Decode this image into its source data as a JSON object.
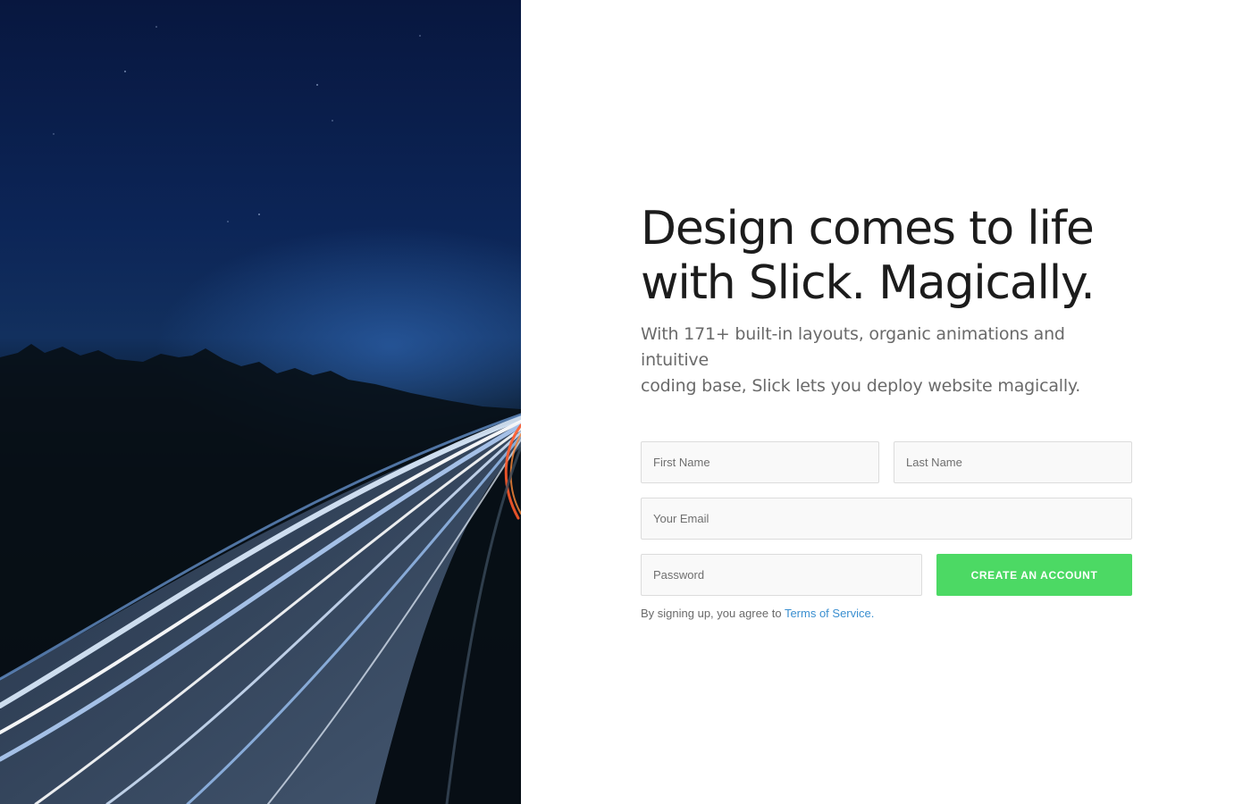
{
  "hero": {
    "image_description_icon": "highway-light-trails-image"
  },
  "headline": {
    "line1": "Design comes to life",
    "line2": "with Slick. Magically."
  },
  "subtitle": {
    "line1": "With 171+ built-in layouts, organic animations and intuitive",
    "line2": "coding base, Slick lets you deploy website magically."
  },
  "form": {
    "first_name_placeholder": "First Name",
    "last_name_placeholder": "Last Name",
    "email_placeholder": "Your Email",
    "password_placeholder": "Password",
    "submit_label": "CREATE AN ACCOUNT",
    "terms_prefix": "By signing up, you agree to",
    "terms_link": "Terms of Service."
  },
  "colors": {
    "accent": "#4cd964",
    "link": "#3a8fd0",
    "heading": "#1c1c1c",
    "body": "#6a6a6a"
  }
}
